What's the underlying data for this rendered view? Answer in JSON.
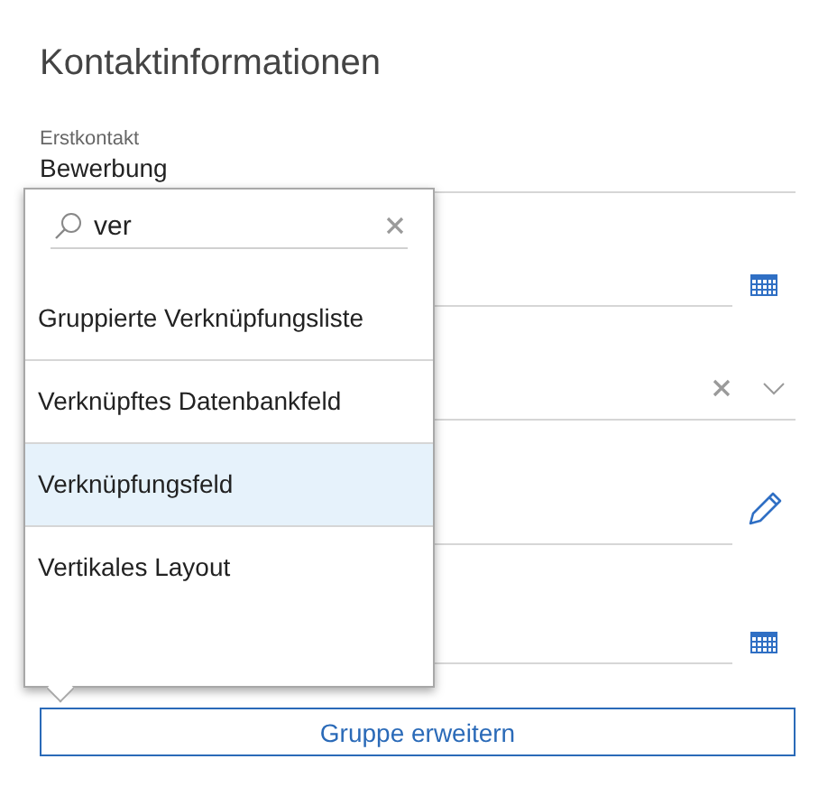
{
  "section_title": "Kontaktinformationen",
  "fields": [
    {
      "kind": "text",
      "label": "Erstkontakt",
      "value": "Bewerbung"
    },
    {
      "kind": "date"
    },
    {
      "kind": "lookup"
    },
    {
      "kind": "edit"
    },
    {
      "kind": "date"
    }
  ],
  "popup": {
    "search": {
      "value": "ver"
    },
    "items": [
      {
        "label": "Gruppierte Verknüpfungsliste",
        "selected": false
      },
      {
        "label": "Verknüpftes Datenbankfeld",
        "selected": false
      },
      {
        "label": "Verknüpfungsfeld",
        "selected": true
      },
      {
        "label": "Vertikales Layout",
        "selected": false
      }
    ]
  },
  "button": {
    "label": "Gruppe erweitern"
  }
}
